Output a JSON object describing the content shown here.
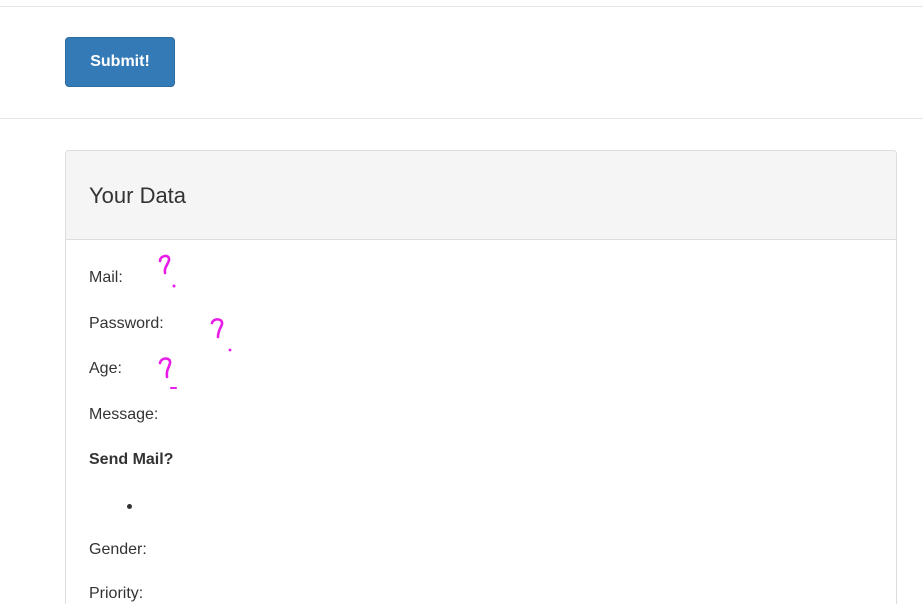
{
  "form": {
    "submit_label": "Submit!"
  },
  "panel": {
    "title": "Your Data",
    "fields": {
      "mail": "Mail:",
      "password": "Password:",
      "age": "Age:",
      "message": "Message:",
      "send_mail": "Send Mail?",
      "gender": "Gender:",
      "priority": "Priority:"
    }
  },
  "annotations": {
    "icon": "question-mark-icon",
    "color": "#e81be8"
  },
  "colors": {
    "primary_button": "#337ab7",
    "panel_heading_bg": "#f5f5f5",
    "border": "#dddddd",
    "text": "#333333"
  }
}
